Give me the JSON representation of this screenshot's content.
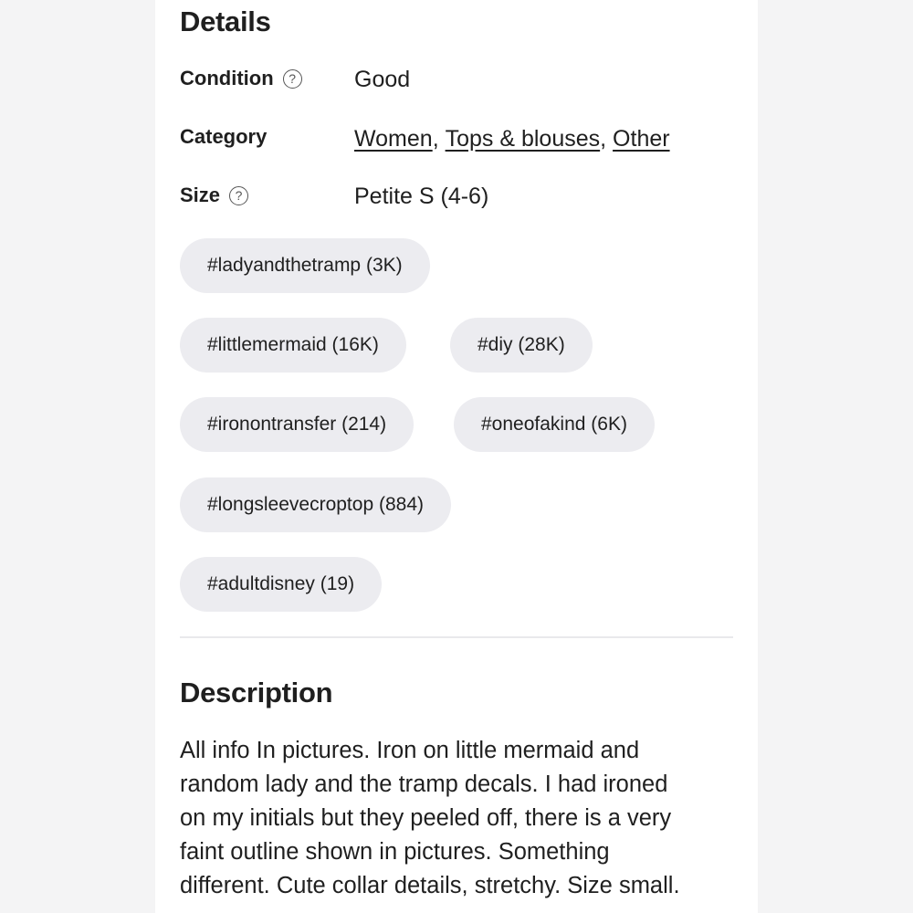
{
  "details": {
    "heading": "Details",
    "condition": {
      "label": "Condition",
      "value": "Good"
    },
    "category": {
      "label": "Category",
      "links": [
        "Women",
        "Tops & blouses",
        "Other"
      ],
      "separator": ","
    },
    "size": {
      "label": "Size",
      "value": "Petite S (4-6)"
    },
    "help_glyph": "?"
  },
  "tags": [
    "#ladyandthetramp (3K)",
    "#littlemermaid (16K)",
    "#diy (28K)",
    "#ironontransfer (214)",
    "#oneofakind (6K)",
    "#longsleevecroptop (884)",
    "#adultdisney (19)"
  ],
  "description": {
    "heading": "Description",
    "text": "All info In pictures. Iron on little mermaid and\nrandom lady and the tramp decals. I had ironed\non my initials but they peeled off, there is a very\nfaint outline shown in pictures. Something\ndifferent. Cute collar details, stretchy.  Size small."
  }
}
